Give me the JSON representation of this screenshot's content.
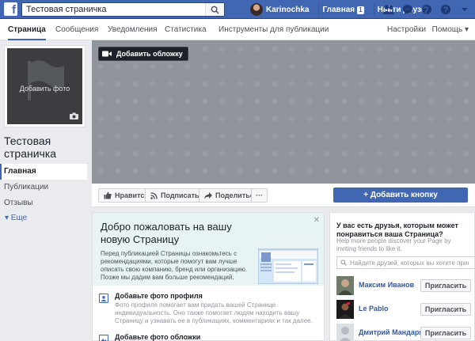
{
  "topbar": {
    "search_value": "Тестовая страничка",
    "user_name": "Karinochka",
    "home_label": "Главная",
    "home_badge": "1",
    "find_friends_label": "Найти друзей"
  },
  "subnav": {
    "tabs": [
      "Страница",
      "Сообщения",
      "Уведомления",
      "Статистика",
      "Инструменты для публикации"
    ],
    "settings_label": "Настройки",
    "help_label": "Помощь ▾"
  },
  "profile": {
    "add_photo_label": "Добавить фото",
    "page_title": "Тестовая страничка"
  },
  "left_nav": {
    "items": [
      "Главная",
      "Публикации",
      "Отзывы"
    ],
    "more_label": "▾ Еще"
  },
  "cover": {
    "add_cover_label": "Добавить обложку"
  },
  "actions": {
    "like_label": "Нравится",
    "subscribe_label": "Подписаться",
    "share_label": "Поделиться",
    "more_label": "···",
    "add_button_label": "+ Добавить кнопку"
  },
  "welcome": {
    "title": "Добро пожаловать на вашу новую Страницу",
    "text": "Перед публикацией Страницы ознакомьтесь с рекомендациями, которые помогут вам лучше описать свою компанию, бренд или организацию. Позже мы дадим вам больше рекомендаций.",
    "steps": [
      {
        "title": "Добавьте фото профиля",
        "text": "Фото профиля помогает вам придать вашей Странице индивидуальность. Оно также помогает людям находить вашу Страницу и узнавать ее в публикациях, комментариях и так далее."
      },
      {
        "title": "Добавьте фото обложки",
        "text": ""
      }
    ]
  },
  "friends": {
    "title": "У вас есть друзья, которым может понравиться ваша Страница?",
    "subtitle": "Help more people discover your Page by inviting friends to like it.",
    "search_placeholder": "Найдите друзей, которых вы хотите пригл...",
    "invite_label": "Пригласить",
    "people": [
      "Максим Иванов",
      "Le Pablo",
      "Дмитрий Мандаря..."
    ]
  },
  "colors": {
    "brand_blue": "#4267b2",
    "cover_gray": "#90949c",
    "welcome_bg": "#e8f4f3"
  }
}
